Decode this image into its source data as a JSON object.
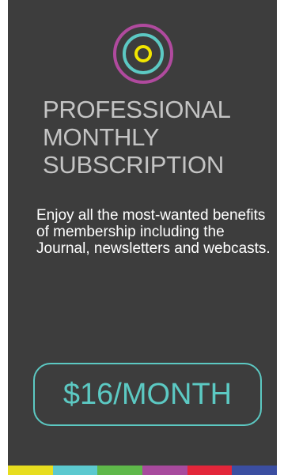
{
  "card": {
    "title_lines": [
      "PROFESSIONAL",
      "MONTHLY",
      "SUBSCRIPTION"
    ],
    "description": "Enjoy all the most-wanted benefits of membership including the Journal, newsletters and webcasts.",
    "price_label": "$16/MONTH",
    "icon": "target-icon"
  },
  "colors": {
    "background": "#3d3d3d",
    "title": "#c4c4c4",
    "accent_teal": "#5cc9c3",
    "ring_magenta": "#b04a9e",
    "ring_yellow": "#f2e600",
    "stripe": [
      "#e7dd1f",
      "#5cc9cf",
      "#5fb84a",
      "#a84a9d",
      "#e3263a",
      "#3b4ea1"
    ]
  }
}
